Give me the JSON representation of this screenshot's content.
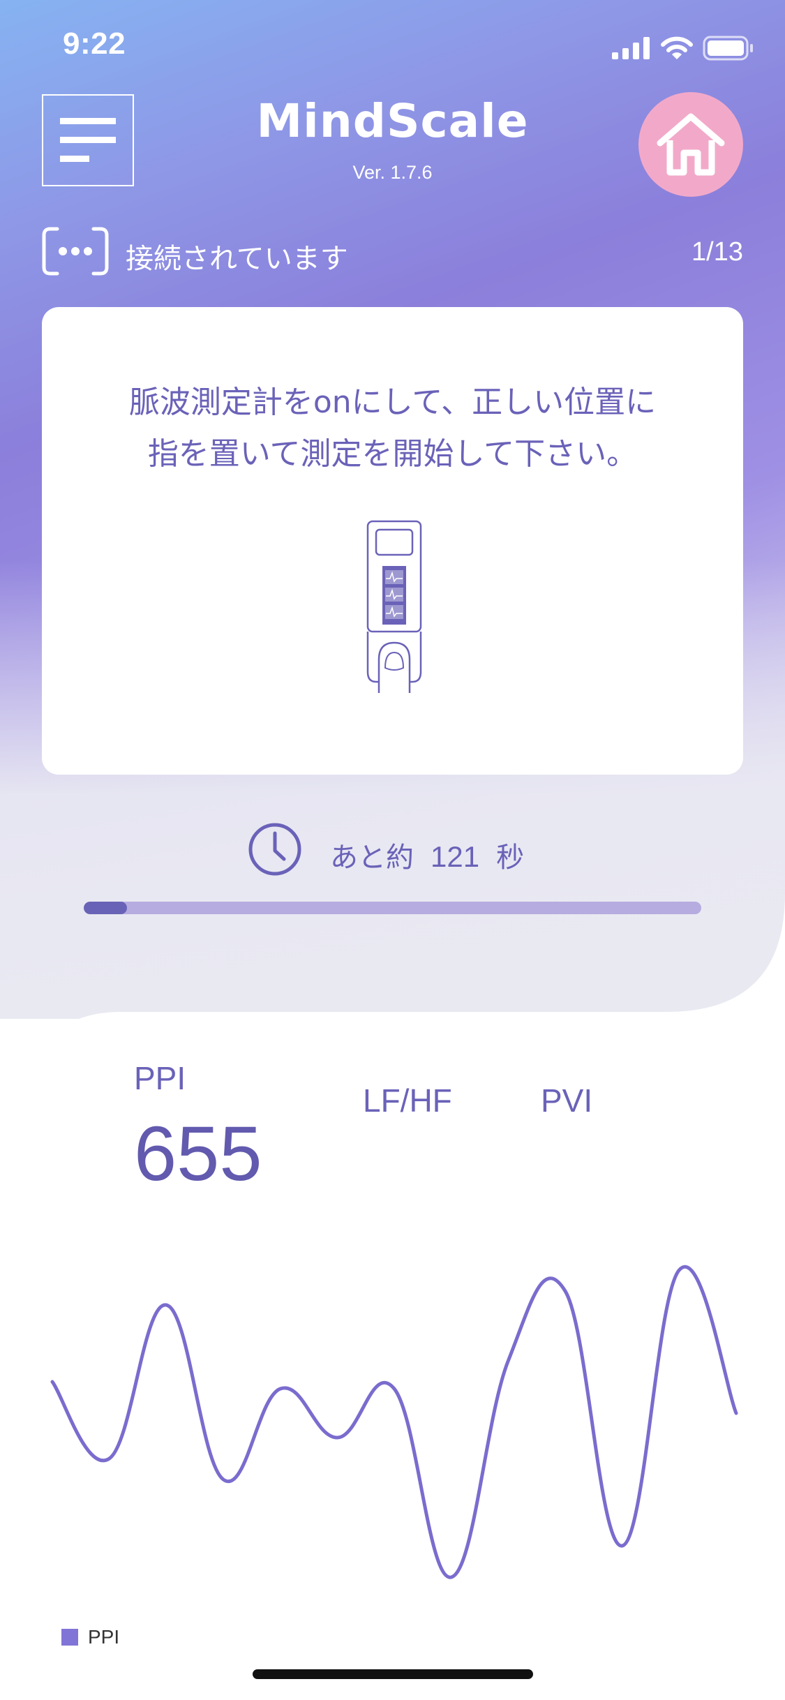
{
  "status_bar": {
    "time": "9:22",
    "icons": [
      "signal-icon",
      "wifi-icon",
      "battery-icon"
    ]
  },
  "header": {
    "title": "MindScale",
    "version": "Ver. 1.7.6",
    "menu_icon": "menu-icon",
    "home_icon": "home-icon"
  },
  "connection": {
    "icon": "bluetooth-device-icon",
    "status": "接続されています",
    "counter": "1/13"
  },
  "instruction_card": {
    "line1": "脈波測定計をonにして、正しい位置に",
    "line2": "指を置いて測定を開始して下さい。",
    "illustration": "pulse-oximeter-finger-icon"
  },
  "timer": {
    "icon": "clock-icon",
    "prefix": "あと約",
    "seconds": "121",
    "unit": "秒",
    "progress": 0.07
  },
  "metrics": {
    "ppi_label": "PPI",
    "ppi_value": "655",
    "lfhf_label": "LF/HF",
    "pvi_label": "PVI"
  },
  "chart_data": {
    "type": "line",
    "series": [
      {
        "name": "PPI",
        "values": [
          0.64,
          0.42,
          0.86,
          0.36,
          0.62,
          0.48,
          0.62,
          0.08,
          0.7,
          0.9,
          0.17,
          0.96,
          0.55
        ]
      }
    ],
    "legend": [
      "PPI"
    ],
    "legend_position": "bottom-left",
    "grid": false,
    "color": "#7a6cce"
  },
  "colors": {
    "accent": "#6a62b8",
    "home_button": "#f2a9c9",
    "progress_fill": "#6863b6",
    "progress_track": "#b6acdf"
  }
}
